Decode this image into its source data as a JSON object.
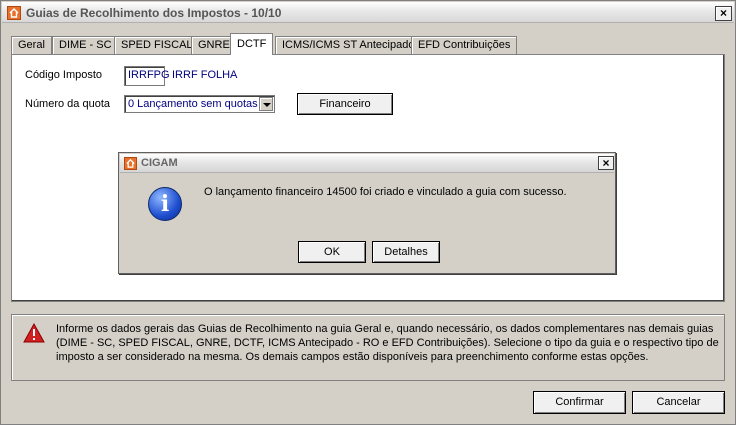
{
  "window": {
    "title": "Guias de Recolhimento dos Impostos - 10/10",
    "close_glyph": "×"
  },
  "tabs": [
    {
      "label": "Geral"
    },
    {
      "label": "DIME - SC"
    },
    {
      "label": "SPED FISCAL"
    },
    {
      "label": "GNRE"
    },
    {
      "label": "DCTF",
      "active": true
    },
    {
      "label": "ICMS/ICMS ST Antecipado"
    },
    {
      "label": "EFD Contribuições"
    }
  ],
  "form": {
    "codigo_label": "Código Imposto",
    "codigo_value": "IRRFPG",
    "codigo_desc": "IRRF FOLHA",
    "quota_label": "Número da quota",
    "quota_value": "0 Lançamento sem quotas",
    "financeiro_button": "Financeiro"
  },
  "dialog": {
    "title": "CIGAM",
    "close_glyph": "×",
    "info_glyph": "i",
    "message": "O lançamento financeiro 14500 foi criado e vinculado a guia com sucesso.",
    "ok_button": "OK",
    "detalhes_button": "Detalhes"
  },
  "help_text": "Informe os dados gerais das Guias de Recolhimento na guia Geral e, quando necessário, os dados complementares nas demais guias (DIME - SC, SPED FISCAL, GNRE, DCTF, ICMS Antecipado - RO e EFD Contribuições). Selecione o tipo da guia e o respectivo tipo de imposto a ser considerado na mesma. Os demais campos estão disponíveis para preenchimento conforme estas opções.",
  "footer": {
    "confirmar_button": "Confirmar",
    "cancelar_button": "Cancelar"
  },
  "colors": {
    "field_text": "#000080",
    "window_bg": "#d4d0c8",
    "warning": "#d02020"
  }
}
